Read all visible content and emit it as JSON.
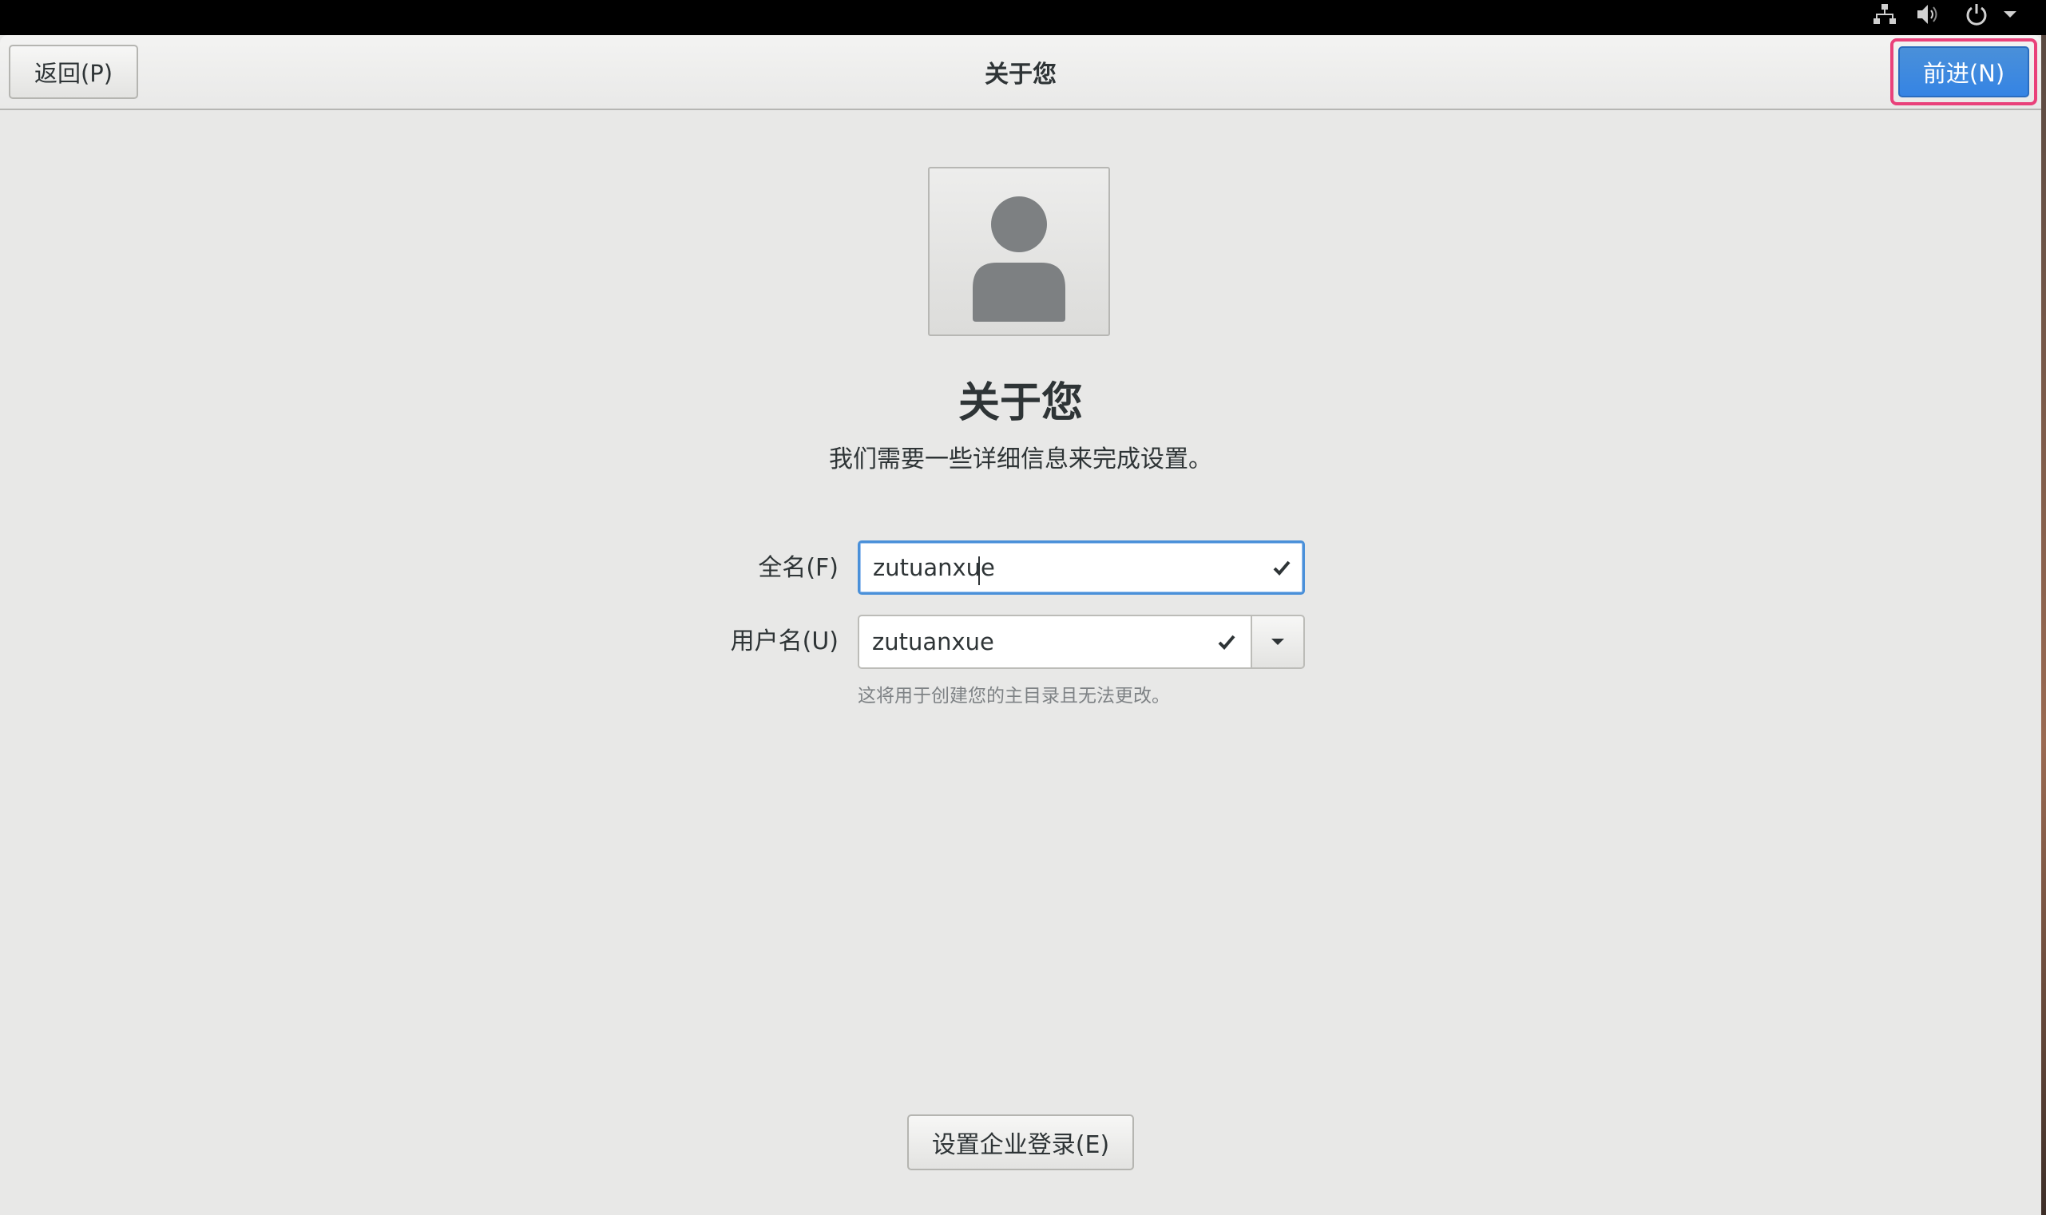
{
  "system_tray": {
    "icons": [
      "network-icon",
      "volume-icon",
      "power-icon",
      "chevron-down-icon"
    ]
  },
  "header": {
    "back_label": "返回(P)",
    "title": "关于您",
    "next_label": "前进(N)"
  },
  "main": {
    "heading": "关于您",
    "subheading": "我们需要一些详细信息来完成设置。",
    "full_name": {
      "label": "全名(F)",
      "value": "zutuanxue"
    },
    "username": {
      "label": "用户名(U)",
      "value": "zutuanxue",
      "hint": "这将用于创建您的主目录且无法更改。"
    },
    "enterprise_login_label": "设置企业登录(E)"
  },
  "colors": {
    "accent": "#3584e4",
    "highlight_border": "#e9417a",
    "background": "#e8e8e7"
  }
}
